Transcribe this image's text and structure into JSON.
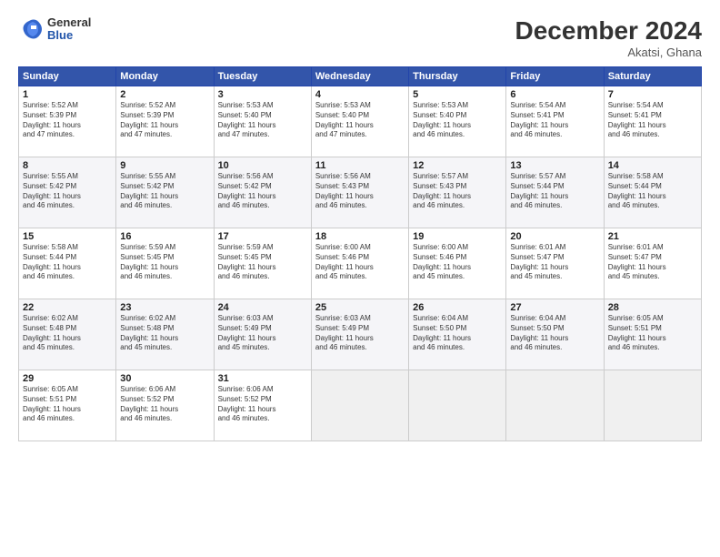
{
  "logo": {
    "general": "General",
    "blue": "Blue"
  },
  "title": "December 2024",
  "location": "Akatsi, Ghana",
  "headers": [
    "Sunday",
    "Monday",
    "Tuesday",
    "Wednesday",
    "Thursday",
    "Friday",
    "Saturday"
  ],
  "weeks": [
    [
      {
        "day": "1",
        "info": "Sunrise: 5:52 AM\nSunset: 5:39 PM\nDaylight: 11 hours\nand 47 minutes."
      },
      {
        "day": "2",
        "info": "Sunrise: 5:52 AM\nSunset: 5:39 PM\nDaylight: 11 hours\nand 47 minutes."
      },
      {
        "day": "3",
        "info": "Sunrise: 5:53 AM\nSunset: 5:40 PM\nDaylight: 11 hours\nand 47 minutes."
      },
      {
        "day": "4",
        "info": "Sunrise: 5:53 AM\nSunset: 5:40 PM\nDaylight: 11 hours\nand 47 minutes."
      },
      {
        "day": "5",
        "info": "Sunrise: 5:53 AM\nSunset: 5:40 PM\nDaylight: 11 hours\nand 46 minutes."
      },
      {
        "day": "6",
        "info": "Sunrise: 5:54 AM\nSunset: 5:41 PM\nDaylight: 11 hours\nand 46 minutes."
      },
      {
        "day": "7",
        "info": "Sunrise: 5:54 AM\nSunset: 5:41 PM\nDaylight: 11 hours\nand 46 minutes."
      }
    ],
    [
      {
        "day": "8",
        "info": "Sunrise: 5:55 AM\nSunset: 5:42 PM\nDaylight: 11 hours\nand 46 minutes."
      },
      {
        "day": "9",
        "info": "Sunrise: 5:55 AM\nSunset: 5:42 PM\nDaylight: 11 hours\nand 46 minutes."
      },
      {
        "day": "10",
        "info": "Sunrise: 5:56 AM\nSunset: 5:42 PM\nDaylight: 11 hours\nand 46 minutes."
      },
      {
        "day": "11",
        "info": "Sunrise: 5:56 AM\nSunset: 5:43 PM\nDaylight: 11 hours\nand 46 minutes."
      },
      {
        "day": "12",
        "info": "Sunrise: 5:57 AM\nSunset: 5:43 PM\nDaylight: 11 hours\nand 46 minutes."
      },
      {
        "day": "13",
        "info": "Sunrise: 5:57 AM\nSunset: 5:44 PM\nDaylight: 11 hours\nand 46 minutes."
      },
      {
        "day": "14",
        "info": "Sunrise: 5:58 AM\nSunset: 5:44 PM\nDaylight: 11 hours\nand 46 minutes."
      }
    ],
    [
      {
        "day": "15",
        "info": "Sunrise: 5:58 AM\nSunset: 5:44 PM\nDaylight: 11 hours\nand 46 minutes."
      },
      {
        "day": "16",
        "info": "Sunrise: 5:59 AM\nSunset: 5:45 PM\nDaylight: 11 hours\nand 46 minutes."
      },
      {
        "day": "17",
        "info": "Sunrise: 5:59 AM\nSunset: 5:45 PM\nDaylight: 11 hours\nand 46 minutes."
      },
      {
        "day": "18",
        "info": "Sunrise: 6:00 AM\nSunset: 5:46 PM\nDaylight: 11 hours\nand 45 minutes."
      },
      {
        "day": "19",
        "info": "Sunrise: 6:00 AM\nSunset: 5:46 PM\nDaylight: 11 hours\nand 45 minutes."
      },
      {
        "day": "20",
        "info": "Sunrise: 6:01 AM\nSunset: 5:47 PM\nDaylight: 11 hours\nand 45 minutes."
      },
      {
        "day": "21",
        "info": "Sunrise: 6:01 AM\nSunset: 5:47 PM\nDaylight: 11 hours\nand 45 minutes."
      }
    ],
    [
      {
        "day": "22",
        "info": "Sunrise: 6:02 AM\nSunset: 5:48 PM\nDaylight: 11 hours\nand 45 minutes."
      },
      {
        "day": "23",
        "info": "Sunrise: 6:02 AM\nSunset: 5:48 PM\nDaylight: 11 hours\nand 45 minutes."
      },
      {
        "day": "24",
        "info": "Sunrise: 6:03 AM\nSunset: 5:49 PM\nDaylight: 11 hours\nand 45 minutes."
      },
      {
        "day": "25",
        "info": "Sunrise: 6:03 AM\nSunset: 5:49 PM\nDaylight: 11 hours\nand 46 minutes."
      },
      {
        "day": "26",
        "info": "Sunrise: 6:04 AM\nSunset: 5:50 PM\nDaylight: 11 hours\nand 46 minutes."
      },
      {
        "day": "27",
        "info": "Sunrise: 6:04 AM\nSunset: 5:50 PM\nDaylight: 11 hours\nand 46 minutes."
      },
      {
        "day": "28",
        "info": "Sunrise: 6:05 AM\nSunset: 5:51 PM\nDaylight: 11 hours\nand 46 minutes."
      }
    ],
    [
      {
        "day": "29",
        "info": "Sunrise: 6:05 AM\nSunset: 5:51 PM\nDaylight: 11 hours\nand 46 minutes."
      },
      {
        "day": "30",
        "info": "Sunrise: 6:06 AM\nSunset: 5:52 PM\nDaylight: 11 hours\nand 46 minutes."
      },
      {
        "day": "31",
        "info": "Sunrise: 6:06 AM\nSunset: 5:52 PM\nDaylight: 11 hours\nand 46 minutes."
      },
      null,
      null,
      null,
      null
    ]
  ]
}
